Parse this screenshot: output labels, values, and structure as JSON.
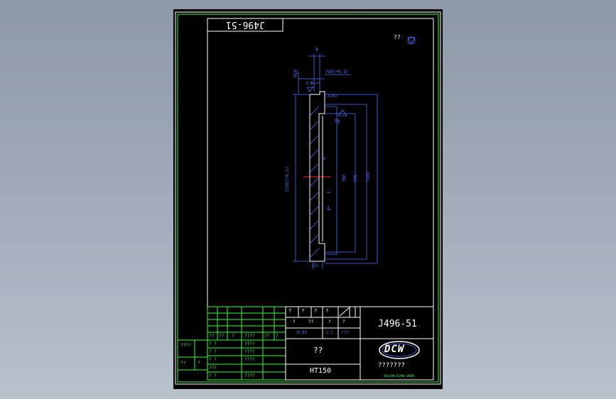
{
  "drawing": {
    "number": "J496-51",
    "number_mirrored": "J496-51",
    "name": "??",
    "material": "HT150",
    "company": "???????",
    "logo_text": "DCW",
    "logo_subtext": "DALIAN DIANG VERPL",
    "corner_mark": "??",
    "colors": {
      "frame": "#ffffff",
      "border": "#33ff33",
      "dim": "#4a70ff",
      "center": "#ff2020",
      "sheet": "#000000"
    }
  },
  "dimensions": {
    "top_small": "8",
    "thread_top": "M10",
    "fit_top": "?89(+0.1)",
    "step": "2.5",
    "chamfer": "2?45",
    "d1": "?80",
    "d2": "?95",
    "d3": "?105",
    "left_dia": "?158(+0.1)",
    "hole_size": "?8",
    "mid_small": "4",
    "mid_small2": "3",
    "bottom": "32"
  },
  "title_block": {
    "row1": [
      "?",
      "?",
      "?",
      "?",
      "???"
    ],
    "row2": [
      "?",
      "?",
      "??",
      "?",
      "?"
    ],
    "row3": [
      "0.82",
      "1:1",
      "???"
    ],
    "signature_header": [
      "??",
      "??",
      "?",
      "????",
      "??",
      "?"
    ],
    "sign_rows": [
      {
        "role": "? ?",
        "sig": "????"
      },
      {
        "role": "? ?",
        "sig": "????"
      },
      {
        "role": "? ?",
        "sig": "????"
      },
      {
        "role": "???",
        "sig": ""
      },
      {
        "role": "? ?",
        "sig": "????"
      }
    ],
    "left_strip": [
      "????",
      "??",
      "?"
    ]
  }
}
